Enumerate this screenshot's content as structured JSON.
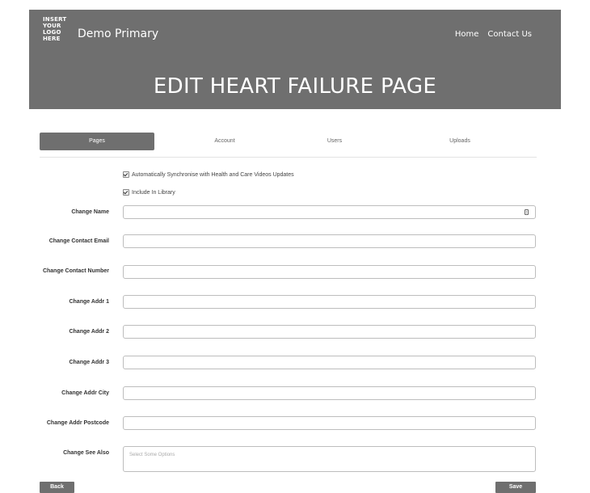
{
  "header": {
    "logo_lines": [
      "INSERT",
      "YOUR",
      "LOGO",
      "HERE"
    ],
    "brand": "Demo Primary",
    "nav": [
      "Home",
      "Contact Us"
    ],
    "title": "EDIT HEART FAILURE PAGE",
    "bg_color": "#6f6f6f"
  },
  "tabs": [
    "Pages",
    "Account",
    "Users",
    "Uploads"
  ],
  "active_tab": "Pages",
  "checkboxes": [
    {
      "label": "Automatically Synchronise with Health and Care Videos Updates",
      "checked": true
    },
    {
      "label": "Include In Library",
      "checked": true
    }
  ],
  "form": {
    "labels": {
      "name": "Change Name",
      "email": "Change Contact Email",
      "number": "Change Contact Number",
      "addr1": "Change Addr 1",
      "addr2": "Change Addr 2",
      "addr3": "Change Addr 3",
      "city": "Change Addr City",
      "postcode": "Change Addr Postcode",
      "see_also": "Change See Also"
    },
    "values": {
      "name": "",
      "email": "",
      "number": "",
      "addr1": "",
      "addr2": "",
      "addr3": "",
      "city": "",
      "postcode": ""
    },
    "see_also_placeholder": "Select Some Options"
  },
  "buttons": {
    "back": "Back",
    "save": "Save"
  },
  "icons": {
    "name_field_icon": "contact-card-icon"
  }
}
